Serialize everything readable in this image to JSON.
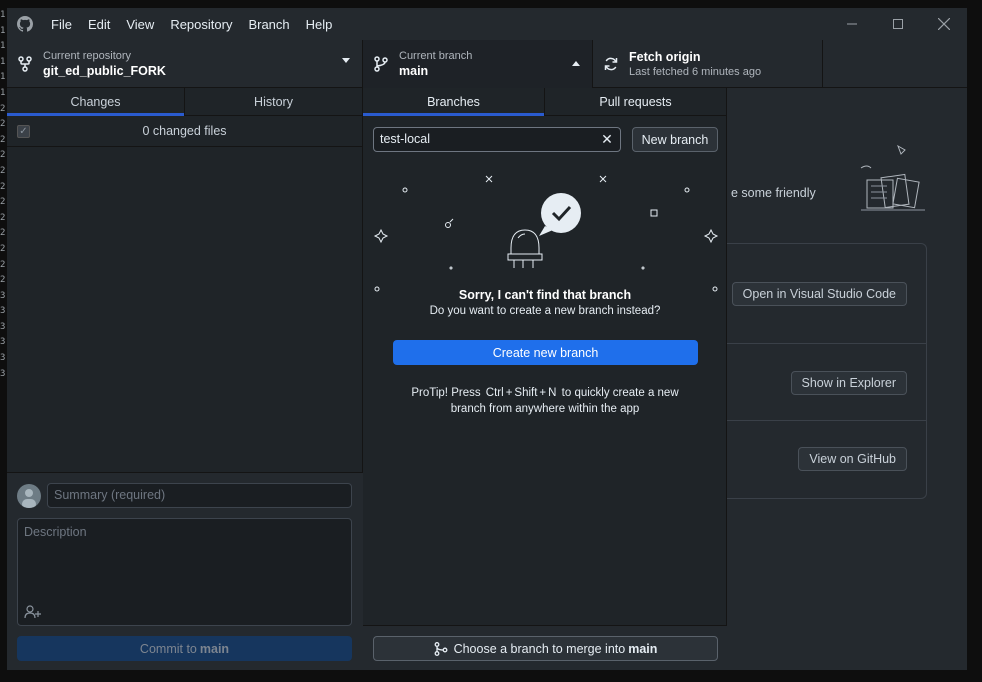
{
  "gutter_numbers": [
    "1",
    "1",
    "1",
    "1",
    "1",
    "1",
    "2",
    "2",
    "2",
    "2",
    "2",
    "2",
    "2",
    "2",
    "2",
    "2",
    "2",
    "2",
    "3",
    "3",
    "3",
    "3",
    "3",
    "3"
  ],
  "menu": [
    "File",
    "Edit",
    "View",
    "Repository",
    "Branch",
    "Help"
  ],
  "toolbar": {
    "repo_label": "Current repository",
    "repo_value": "git_ed_public_FORK",
    "branch_label": "Current branch",
    "branch_value": "main",
    "fetch_label": "Fetch origin",
    "fetch_sub": "Last fetched 6 minutes ago"
  },
  "left": {
    "tabs": [
      "Changes",
      "History"
    ],
    "changed_files": "0 changed files",
    "summary_placeholder": "Summary (required)",
    "description_placeholder": "Description",
    "commit_prefix": "Commit to",
    "commit_branch": "main"
  },
  "right": {
    "friendly_text": "e some friendly",
    "open_vscode": "Open in Visual Studio Code",
    "show_explorer": "Show in Explorer",
    "view_github": "View on GitHub"
  },
  "dropdown": {
    "tabs": [
      "Branches",
      "Pull requests"
    ],
    "filter_value": "test-local",
    "new_branch": "New branch",
    "sorry_title": "Sorry, I can't find that branch",
    "sorry_sub": "Do you want to create a new branch instead?",
    "create_button": "Create new branch",
    "protip_prefix": "ProTip! Press",
    "key_ctrl": "Ctrl",
    "key_shift": "Shift",
    "key_n": "N",
    "protip_mid": "to quickly create a new",
    "protip_line2": "branch from anywhere within the app",
    "merge_prefix": "Choose a branch to merge into",
    "merge_branch": "main"
  },
  "colors": {
    "accent": "#1f6feb",
    "tab_underline": "#2a5bcf",
    "background": "#24292e"
  }
}
